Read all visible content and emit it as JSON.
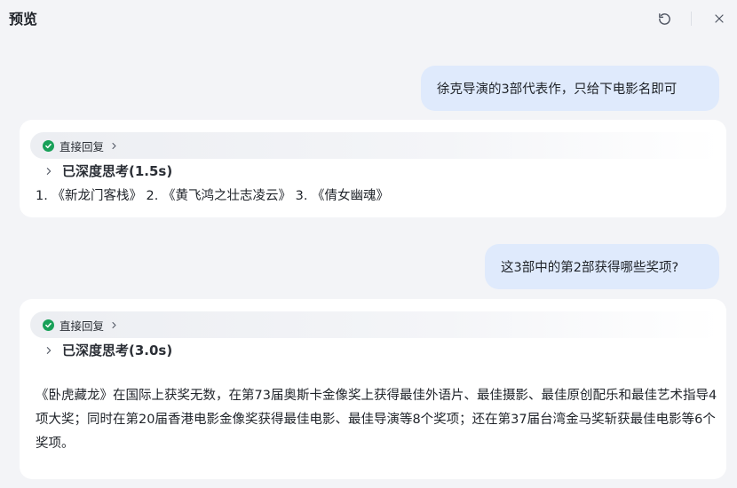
{
  "header": {
    "title": "预览",
    "refresh_icon": "refresh-icon",
    "close_icon": "close-icon"
  },
  "messages": [
    {
      "role": "user",
      "text": "徐克导演的3部代表作，只给下电影名即可"
    },
    {
      "role": "assistant",
      "reply_mode": "直接回复",
      "thinking": "已深度思考(1.5s)",
      "answer": "1. 《新龙门客栈》 2. 《黄飞鸿之壮志凌云》 3. 《倩女幽魂》"
    },
    {
      "role": "user",
      "text": "这3部中的第2部获得哪些奖项?"
    },
    {
      "role": "assistant",
      "reply_mode": "直接回复",
      "thinking": "已深度思考(3.0s)",
      "answer": "《卧虎藏龙》在国际上获奖无数，在第73届奥斯卡金像奖上获得最佳外语片、最佳摄影、最佳原创配乐和最佳艺术指导4项大奖；同时在第20届香港电影金像奖获得最佳电影、最佳导演等8个奖项；还在第37届台湾金马奖斩获最佳电影等6个奖项。"
    }
  ],
  "colors": {
    "background": "#f3f4f7",
    "user_bubble": "#dfeafc",
    "card": "#ffffff",
    "check": "#18a058"
  }
}
